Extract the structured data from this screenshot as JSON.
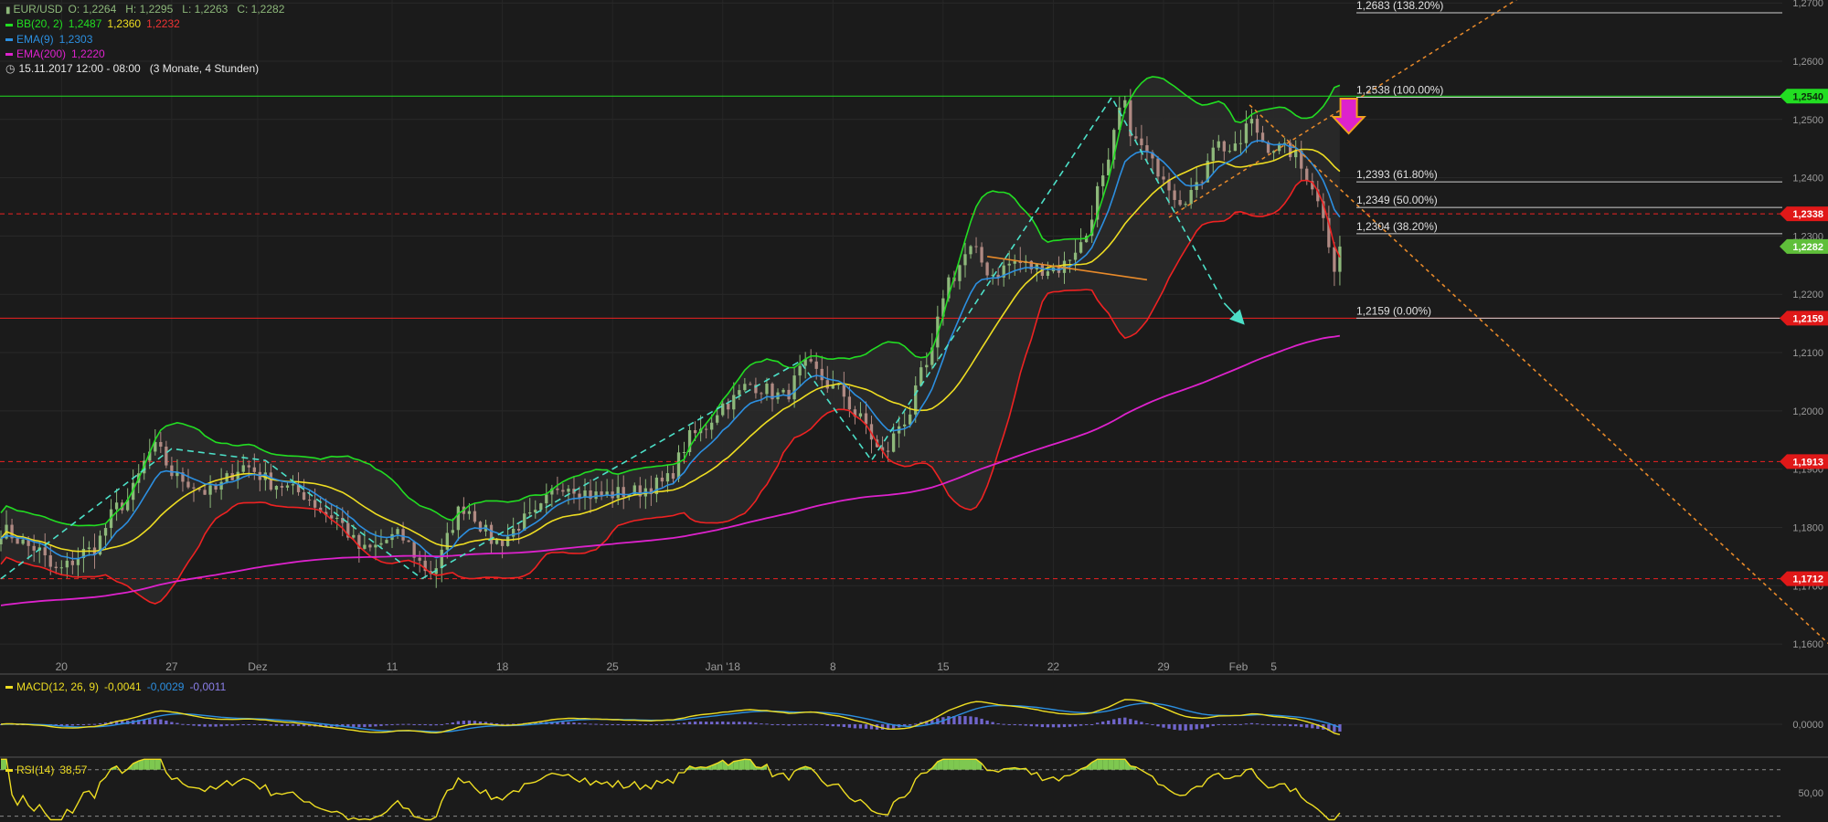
{
  "legend": {
    "symbol": "EUR/USD",
    "ohlc": "O: 1,2264   H: 1,2295   L: 1,2263   C: 1,2282",
    "bb_label": "BB(20, 2)",
    "bb_upper": "1,2487",
    "bb_mid": "1,2360",
    "bb_lower": "1,2232",
    "ema9_label": "EMA(9)",
    "ema9_value": "1,2303",
    "ema200_label": "EMA(200)",
    "ema200_value": "1,2220",
    "period": "15.11.2017 12:00 - 08:00   (3 Monate, 4 Stunden)"
  },
  "macd_legend": {
    "label": "MACD(12, 26, 9)",
    "v1": "-0,0041",
    "v2": "-0,0029",
    "v3": "-0,0011"
  },
  "rsi_legend": {
    "label": "RSI(14)",
    "value": "38,57"
  },
  "colors": {
    "up": "#8db87a",
    "down": "#b08a83",
    "bb_upper": "#22dd22",
    "bb_lower": "#ee2222",
    "bb_mid": "#eedd22",
    "ema9": "#2c8fe0",
    "ema200": "#dd22cc",
    "fib": "#cfcfcf",
    "trend_dash": "#4ce0c8",
    "orange": "#e88a2a"
  },
  "chart_data": {
    "type": "candlestick",
    "instrument": "EUR/USD",
    "timeframe": "4 Stunden",
    "range": "15.11.2017 12:00 - 08:00",
    "ylim": [
      1.155,
      1.2705
    ],
    "y_ticks": [
      1.16,
      1.17,
      1.18,
      1.19,
      1.2,
      1.21,
      1.22,
      1.23,
      1.24,
      1.25,
      1.26,
      1.27
    ],
    "y_tick_labels": [
      "1,1600",
      "1,1700",
      "1,1800",
      "1,1900",
      "1,2000",
      "1,2100",
      "1,2200",
      "1,2300",
      "1,2400",
      "1,2500",
      "1,2600",
      "1,2700"
    ],
    "x_ticks": [
      {
        "t": 5.5,
        "label": "20"
      },
      {
        "t": 15.5,
        "label": "27"
      },
      {
        "t": 23.3,
        "label": "Dez"
      },
      {
        "t": 35.5,
        "label": "11"
      },
      {
        "t": 45.5,
        "label": "18"
      },
      {
        "t": 55.5,
        "label": "25"
      },
      {
        "t": 65.5,
        "label": "Jan '18"
      },
      {
        "t": 75.5,
        "label": "8"
      },
      {
        "t": 85.5,
        "label": "15"
      },
      {
        "t": 95.5,
        "label": "22"
      },
      {
        "t": 105.5,
        "label": "29"
      },
      {
        "t": 112.3,
        "label": "Feb"
      },
      {
        "t": 115.5,
        "label": "5"
      }
    ],
    "candles_per_unit": 2,
    "close_anchors": [
      [
        0,
        1.1795
      ],
      [
        3,
        1.1765
      ],
      [
        5,
        1.1725
      ],
      [
        8,
        1.176
      ],
      [
        11,
        1.184
      ],
      [
        14,
        1.1935
      ],
      [
        16,
        1.1885
      ],
      [
        19,
        1.186
      ],
      [
        22,
        1.1905
      ],
      [
        25,
        1.1875
      ],
      [
        27,
        1.186
      ],
      [
        30,
        1.182
      ],
      [
        33,
        1.176
      ],
      [
        36,
        1.1785
      ],
      [
        39,
        1.1725
      ],
      [
        42,
        1.1835
      ],
      [
        45,
        1.1775
      ],
      [
        48,
        1.1815
      ],
      [
        51,
        1.1875
      ],
      [
        54,
        1.1855
      ],
      [
        57,
        1.186
      ],
      [
        60,
        1.1875
      ],
      [
        63,
        1.196
      ],
      [
        66,
        1.2015
      ],
      [
        68,
        1.2045
      ],
      [
        71,
        1.2025
      ],
      [
        73,
        1.2075
      ],
      [
        76,
        1.2035
      ],
      [
        78,
        1.1985
      ],
      [
        80,
        1.1925
      ],
      [
        82,
        1.1985
      ],
      [
        84,
        1.2075
      ],
      [
        86,
        1.2225
      ],
      [
        88,
        1.2275
      ],
      [
        90,
        1.2235
      ],
      [
        92,
        1.2255
      ],
      [
        94,
        1.2245
      ],
      [
        96,
        1.2245
      ],
      [
        98,
        1.2285
      ],
      [
        100,
        1.2395
      ],
      [
        101.8,
        1.2525
      ],
      [
        103,
        1.246
      ],
      [
        105,
        1.2415
      ],
      [
        107,
        1.2365
      ],
      [
        108.5,
        1.238
      ],
      [
        110,
        1.246
      ],
      [
        112,
        1.2445
      ],
      [
        113.3,
        1.2495
      ],
      [
        115,
        1.2455
      ],
      [
        117,
        1.2445
      ],
      [
        118.5,
        1.2405
      ],
      [
        120,
        1.234
      ],
      [
        121,
        1.2245
      ],
      [
        121.8,
        1.2282
      ]
    ],
    "series": [
      {
        "name": "EMA(9)",
        "role": "ema9",
        "last": 1.2303
      },
      {
        "name": "BB(20, 2)",
        "role": "bands",
        "upper_last": 1.2487,
        "mid_last": 1.236,
        "lower_last": 1.2232
      },
      {
        "name": "EMA(200)",
        "role": "ema200",
        "last": 1.222
      }
    ],
    "fibonacci": [
      {
        "price": 1.2683,
        "label": "1,2683 (138.20%)"
      },
      {
        "price": 1.2538,
        "label": "1,2538 (100.00%)"
      },
      {
        "price": 1.2393,
        "label": "1,2393 (61.80%)"
      },
      {
        "price": 1.2349,
        "label": "1,2349 (50.00%)"
      },
      {
        "price": 1.2304,
        "label": "1,2304 (38.20%)"
      },
      {
        "price": 1.2159,
        "label": "1,2159 (0.00%)"
      }
    ],
    "levels": [
      {
        "price": 1.254,
        "label": "1,2540",
        "style": "solid",
        "color": "#22dd22"
      },
      {
        "price": 1.2338,
        "label": "1,2338",
        "style": "dashed",
        "color": "#ee2222"
      },
      {
        "price": 1.2159,
        "label": "1,2159",
        "style": "solid",
        "color": "#ee2222"
      },
      {
        "price": 1.1913,
        "label": "1,1913",
        "style": "dashed",
        "color": "#ee2222"
      },
      {
        "price": 1.1712,
        "label": "1,1712",
        "style": "dashed",
        "color": "#ee2222"
      }
    ],
    "last_price": {
      "price": 1.2282,
      "label": "1,2282"
    },
    "trendlines": [
      {
        "points": [
          [
            0,
            1.1712
          ],
          [
            15.5,
            1.1935
          ],
          [
            24,
            1.1915
          ],
          [
            38.2,
            1.1712
          ]
        ],
        "color": "#4ce0c8",
        "dash": true
      },
      {
        "points": [
          [
            38.2,
            1.1712
          ],
          [
            72.5,
            1.2085
          ],
          [
            79,
            1.1915
          ],
          [
            100.8,
            1.2538
          ],
          [
            111,
            1.2185
          ]
        ],
        "color": "#4ce0c8",
        "dash": true
      },
      {
        "points": [
          [
            111,
            1.2185
          ],
          [
            112.5,
            1.2155
          ]
        ],
        "color": "#4ce0c8",
        "dash": false,
        "arrow": true
      },
      {
        "points": [
          [
            89.5,
            1.2265
          ],
          [
            104,
            1.2225
          ]
        ],
        "color": "#e88a2a",
        "dash": false
      },
      {
        "points": [
          [
            106,
            1.2332
          ],
          [
            140,
            1.2735
          ]
        ],
        "color": "#e88a2a",
        "dash": true
      },
      {
        "points": [
          [
            113.3,
            1.2525
          ],
          [
            166,
            1.1598
          ]
        ],
        "color": "#e88a2a",
        "dash": true
      }
    ],
    "signal_arrow": {
      "t": 122.3,
      "price": 1.2495,
      "direction": "down",
      "color": "#dd22cc"
    },
    "macd": {
      "ylim": [
        -0.012,
        0.014
      ],
      "tick": {
        "value": 0,
        "label": "0,0000"
      }
    },
    "rsi": {
      "ylim": [
        25,
        80
      ],
      "upper": 70,
      "lower": 30,
      "tick": {
        "value": 50,
        "label": "50,00"
      }
    }
  }
}
